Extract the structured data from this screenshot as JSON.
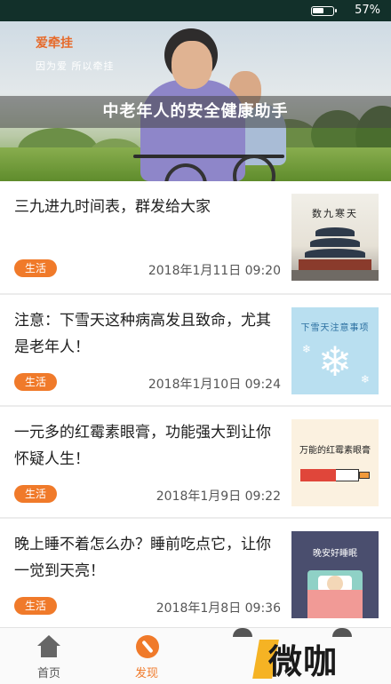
{
  "status_bar": {
    "battery_percent": "57%",
    "battery_level": 0.57
  },
  "banner": {
    "brand_logo": "爱牵挂",
    "slogan": "因为爱 所以牵挂",
    "title": "中老年人的安全健康助手"
  },
  "articles": [
    {
      "title": "三九进九时间表，群发给大家",
      "tag": "生活",
      "date": "2018年1月11日 09:20",
      "thumb_caption": "数九寒天",
      "thumb_icon": "temple-image"
    },
    {
      "title": "注意：下雪天这种病高发且致命，尤其是老年人！",
      "tag": "生活",
      "date": "2018年1月10日 09:24",
      "thumb_caption": "下雪天注意事项",
      "thumb_icon": "snowflake-image"
    },
    {
      "title": "一元多的红霉素眼膏，功能强大到让你怀疑人生！",
      "tag": "生活",
      "date": "2018年1月9日 09:22",
      "thumb_caption": "万能的红霉素眼膏",
      "thumb_icon": "ointment-image"
    },
    {
      "title": "晚上睡不着怎么办？睡前吃点它，让你一觉到天亮！",
      "tag": "生活",
      "date": "2018年1月8日 09:36",
      "thumb_caption": "晚安好睡眠",
      "thumb_icon": "sleep-image"
    }
  ],
  "bottom_nav": {
    "items": [
      {
        "label": "首页",
        "icon": "home-icon",
        "active": false
      },
      {
        "label": "发现",
        "icon": "compass-icon",
        "active": true
      }
    ]
  },
  "watermark": {
    "text": "微咖"
  },
  "colors": {
    "accent": "#f07a2a",
    "status_bar": "#12302a"
  }
}
